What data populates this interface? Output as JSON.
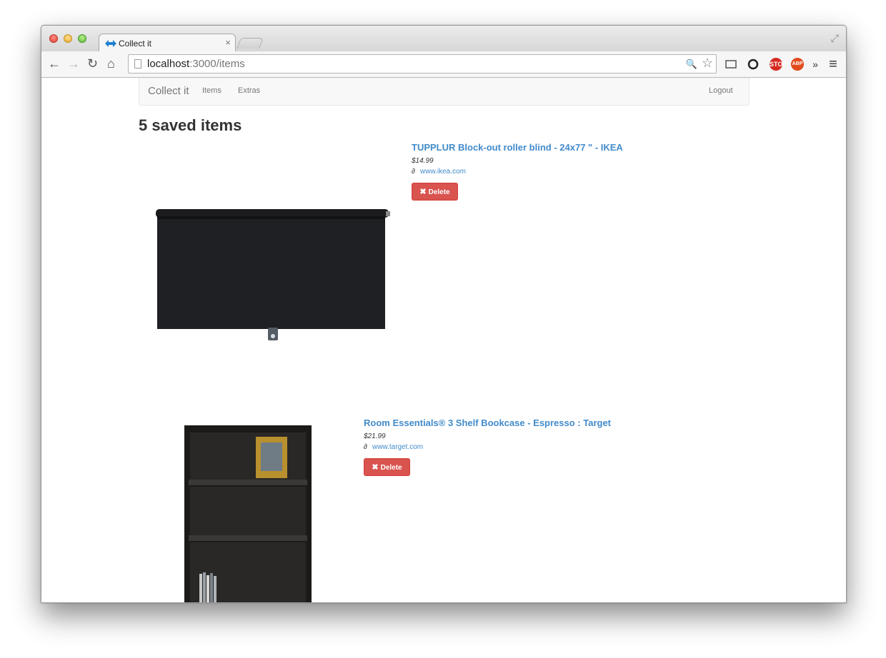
{
  "browser": {
    "tab_title": "Collect it",
    "tab_close": "×",
    "url_host": "localhost",
    "url_path": ":3000/items",
    "back_glyph": "←",
    "forward_glyph": "→",
    "reload_glyph": "↻",
    "home_glyph": "⌂",
    "search_glyph": "🔍",
    "star_glyph": "☆",
    "overflow_glyph": "»",
    "menu_glyph": "≡",
    "fullscreen_glyph": "⤢",
    "ext_stop_label": "STOP",
    "ext_abp_label": "ABP"
  },
  "navbar": {
    "brand": "Collect it",
    "items_label": "Items",
    "extras_label": "Extras",
    "logout_label": "Logout"
  },
  "page": {
    "heading": "5 saved items"
  },
  "items": [
    {
      "title": "TUPPLUR Block-out roller blind - 24x77 \" - IKEA",
      "price": "$14.99",
      "domain": "www.ikea.com",
      "delete_label": "Delete"
    },
    {
      "title": "Room Essentials® 3 Shelf Bookcase - Espresso : Target",
      "price": "$21.99",
      "domain": "www.target.com",
      "delete_label": "Delete"
    }
  ],
  "icons": {
    "delete": "✖",
    "link": "🔗"
  }
}
